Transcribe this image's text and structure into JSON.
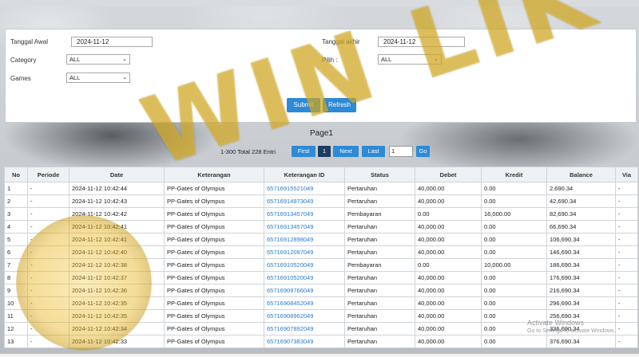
{
  "filters": {
    "start_date_label": "Tanggal Awal",
    "start_date_value": "2024-11-12",
    "end_date_label": "Tanggal akhir",
    "end_date_value": "2024-11-12",
    "category_label": "Category",
    "category_value": "ALL",
    "pilih_label": "Pilih  :",
    "pilih_value": "ALL",
    "games_label": "Games",
    "games_value": "ALL",
    "submit_label": "Submit",
    "refresh_label": "Refresh"
  },
  "pager": {
    "title": "Page1",
    "info": "1-300 Total 228 Entri",
    "first": "First",
    "current": "1",
    "next": "Next",
    "last": "Last",
    "page_input": "1",
    "go": "Go"
  },
  "table": {
    "headers": [
      "No",
      "Periode",
      "Date",
      "Keterangan",
      "Keterangan ID",
      "Status",
      "Debet",
      "Kredit",
      "Balance",
      "Via"
    ],
    "rows": [
      [
        "1",
        "-",
        "2024-11-12 10:42:44",
        "PP-Gates of Olympus",
        "65716915521049",
        "Pertaruhan",
        "40,000.00",
        "0.00",
        "2,690.34",
        "-"
      ],
      [
        "2",
        "-",
        "2024-11-12 10:42:43",
        "PP-Gates of Olympus",
        "65716914973049",
        "Pertaruhan",
        "40,000.00",
        "0.00",
        "42,690.34",
        "-"
      ],
      [
        "3",
        "-",
        "2024-11-12 10:42:42",
        "PP-Gates of Olympus",
        "65716913457049",
        "Pembayaran",
        "0.00",
        "16,000.00",
        "82,690.34",
        "-"
      ],
      [
        "4",
        "-",
        "2024-11-12 10:42:41",
        "PP-Gates of Olympus",
        "65716913457049",
        "Pertaruhan",
        "40,000.00",
        "0.00",
        "66,690.34",
        "-"
      ],
      [
        "5",
        "-",
        "2024-11-12 10:42:41",
        "PP-Gates of Olympus",
        "65716912898049",
        "Pertaruhan",
        "40,000.00",
        "0.00",
        "106,690.34",
        "-"
      ],
      [
        "6",
        "-",
        "2024-11-12 10:42:40",
        "PP-Gates of Olympus",
        "65716912087049",
        "Pertaruhan",
        "40,000.00",
        "0.00",
        "146,690.34",
        "-"
      ],
      [
        "7",
        "-",
        "2024-11-12 10:42:38",
        "PP-Gates of Olympus",
        "65716910520049",
        "Pembayaran",
        "0.00",
        "10,000.00",
        "186,690.34",
        "-"
      ],
      [
        "8",
        "-",
        "2024-11-12 10:42:37",
        "PP-Gates of Olympus",
        "65716910520049",
        "Pertaruhan",
        "40,000.00",
        "0.00",
        "176,690.34",
        "-"
      ],
      [
        "9",
        "-",
        "2024-11-12 10:42:36",
        "PP-Gates of Olympus",
        "65716909766049",
        "Pertaruhan",
        "40,000.00",
        "0.00",
        "216,690.34",
        "-"
      ],
      [
        "10",
        "-",
        "2024-11-12 10:42:35",
        "PP-Gates of Olympus",
        "65716908452049",
        "Pertaruhan",
        "40,000.00",
        "0.00",
        "296,690.34",
        "-"
      ],
      [
        "11",
        "-",
        "2024-11-12 10:42:35",
        "PP-Gates of Olympus",
        "65716908962049",
        "Pertaruhan",
        "40,000.00",
        "0.00",
        "256,690.34",
        "-"
      ],
      [
        "12",
        "-",
        "2024-11-12 10:42:34",
        "PP-Gates of Olympus",
        "65716907892049",
        "Pertaruhan",
        "40,000.00",
        "0.00",
        "336,690.34",
        "-"
      ],
      [
        "13",
        "-",
        "2024-11-12 10:42:33",
        "PP-Gates of Olympus",
        "65716907383049",
        "Pertaruhan",
        "40,000.00",
        "0.00",
        "376,690.34",
        "-"
      ]
    ]
  },
  "watermark": {
    "text": "WIN LIK"
  },
  "windows_activation": {
    "title": "Activate Windows",
    "subtitle": "Go to Settings to activate Windows."
  }
}
